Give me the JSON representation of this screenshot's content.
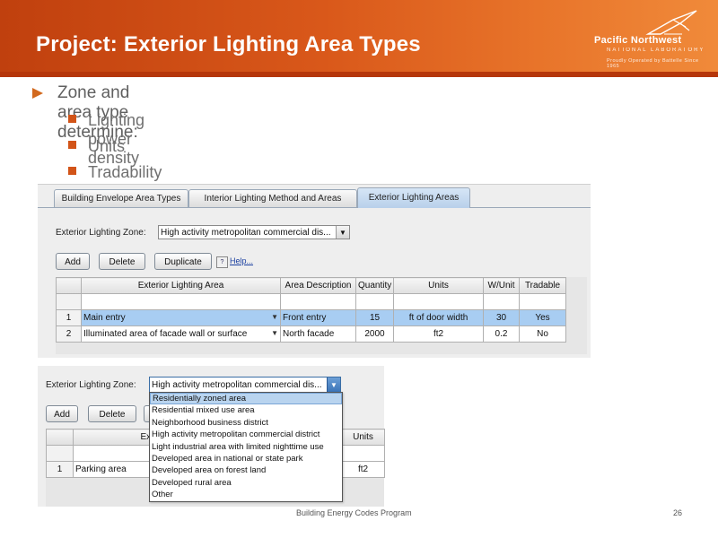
{
  "slide": {
    "title": "Project: Exterior Lighting Area Types",
    "logo": {
      "line1": "Pacific Northwest",
      "line2": "NATIONAL LABORATORY",
      "line3": "Proudly Operated by Battelle Since 1965"
    },
    "bullets": [
      {
        "text": "Zone and area type determine:",
        "subs": [
          "Lighting power density",
          "Units",
          "Tradability"
        ]
      }
    ],
    "footer": {
      "program": "Building Energy Codes Program",
      "page": "26"
    }
  },
  "app": {
    "tabs": [
      "Building Envelope Area Types",
      "Interior Lighting Method and Areas",
      "Exterior Lighting Areas"
    ],
    "active_tab": 2,
    "zone_label": "Exterior Lighting Zone:",
    "zone_value": "High activity metropolitan commercial dis...",
    "buttons": {
      "add": "Add",
      "delete": "Delete",
      "duplicate": "Duplicate",
      "help": "Help..."
    },
    "table": {
      "headers": [
        "Exterior Lighting Area",
        "Area Description",
        "Quantity",
        "Units",
        "W/Unit",
        "Tradable"
      ],
      "rows": [
        {
          "num": "1",
          "area": "Main entry",
          "desc": "Front entry",
          "qty": "15",
          "units": "ft of door width",
          "wunit": "30",
          "tradable": "Yes"
        },
        {
          "num": "2",
          "area": "Illuminated area of facade wall or surface",
          "desc": "North facade",
          "qty": "2000",
          "units": "ft2",
          "wunit": "0.2",
          "tradable": "No"
        }
      ]
    }
  },
  "app2": {
    "zone_label": "Exterior Lighting Zone:",
    "zone_value": "High activity metropolitan commercial dis...",
    "buttons": {
      "add": "Add",
      "delete": "Delete"
    },
    "header_area": "Exterior Li",
    "header_units": "Units",
    "row": {
      "num": "1",
      "area": "Parking area",
      "units": "ft2"
    },
    "options": [
      "Residentially zoned area",
      "Residential mixed use area",
      "Neighborhood business district",
      "High activity metropolitan commercial district",
      "Light industrial area with limited nighttime use",
      "Developed area in national or state park",
      "Developed area on forest land",
      "Developed rural area",
      "Other"
    ],
    "highlighted_option": 0
  }
}
